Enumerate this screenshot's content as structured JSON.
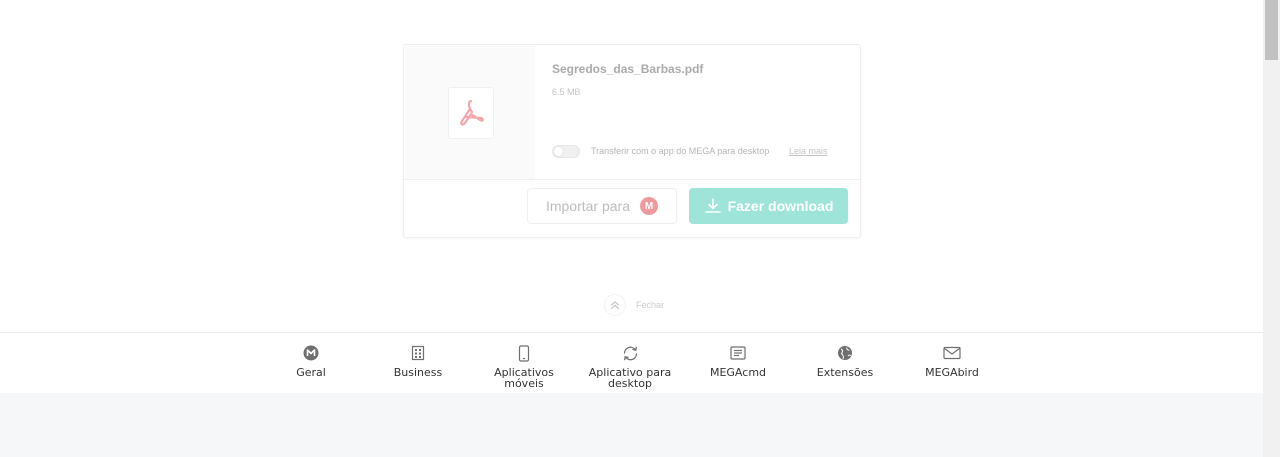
{
  "file": {
    "name": "Segredos_das_Barbas.pdf",
    "size": "6.5 MB",
    "icon": "pdf-icon",
    "desktop_app_toggle": {
      "label": "Transferir com o app do MEGA para desktop",
      "enabled": false,
      "learn_more": "Leia mais"
    }
  },
  "actions": {
    "import_label": "Importar para",
    "import_badge": "M",
    "download_label": "Fazer download"
  },
  "close": {
    "label": "Fechar",
    "icon": "double-chevron-up-icon"
  },
  "nav": {
    "items": [
      {
        "label": "Geral",
        "icon": "mega-logo-icon"
      },
      {
        "label": "Business",
        "icon": "building-icon"
      },
      {
        "label": "Aplicativos\nmóveis",
        "icon": "phone-icon"
      },
      {
        "label": "Aplicativo para\ndesktop",
        "icon": "sync-icon"
      },
      {
        "label": "MEGAcmd",
        "icon": "terminal-icon"
      },
      {
        "label": "Extensões",
        "icon": "globe-icon"
      },
      {
        "label": "MEGAbird",
        "icon": "mail-icon"
      }
    ]
  },
  "colors": {
    "download_button": "#9fe4d9",
    "mega_badge": "#f09a9e",
    "pdf_icon": "#f4a7ab",
    "page_bottom": "#f6f7f9"
  }
}
